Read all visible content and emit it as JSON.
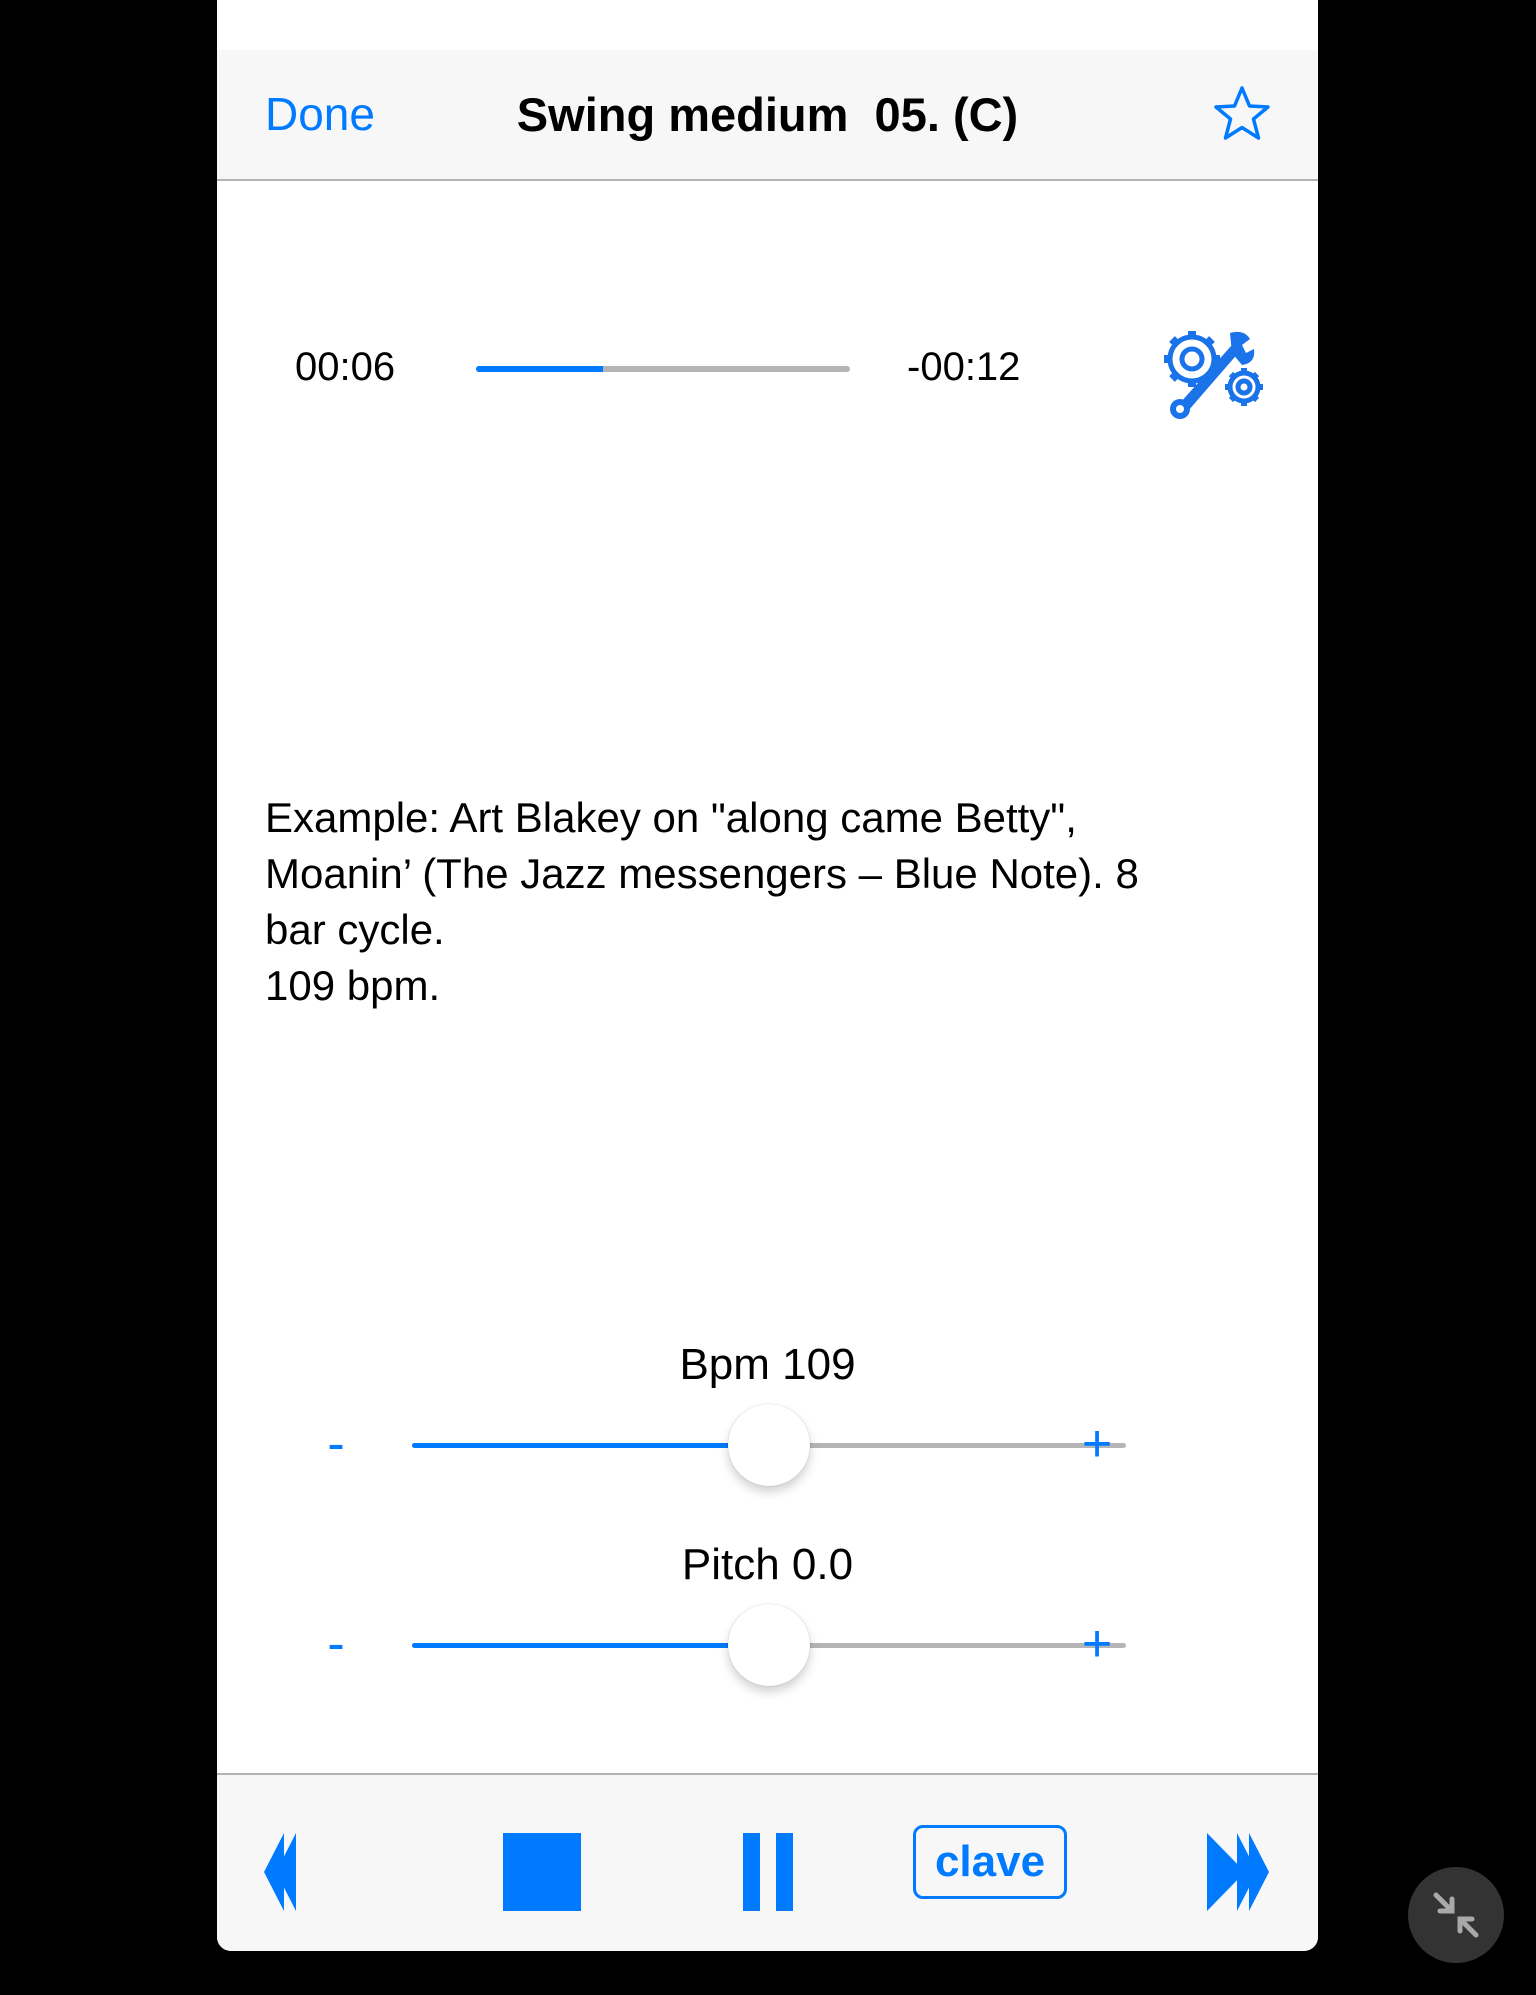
{
  "navbar": {
    "done_label": "Done",
    "title": "Swing medium  05. (C)",
    "favorite_icon": "star-outline-icon"
  },
  "player": {
    "elapsed": "00:06",
    "remaining": "-00:12",
    "progress_fraction": 0.34,
    "settings_icon": "gears-wrench-icon"
  },
  "description": {
    "lines": [
      "Example: Art Blakey on \"along came Betty\",",
      "Moanin’ (The Jazz messengers – Blue Note). 8",
      "bar cycle.",
      "109 bpm."
    ]
  },
  "bpm": {
    "label": "Bpm 109",
    "value": 109,
    "position_fraction": 0.5,
    "minus_label": "-",
    "plus_label": "+"
  },
  "pitch": {
    "label": "Pitch 0.0",
    "value": 0.0,
    "position_fraction": 0.5,
    "minus_label": "-",
    "plus_label": "+"
  },
  "toolbar": {
    "rewind_icon": "rewind-icon",
    "stop_icon": "stop-icon",
    "pause_icon": "pause-icon",
    "clave_label": "clave",
    "forward_icon": "fast-forward-icon"
  },
  "overlay": {
    "exit_fullscreen_icon": "shrink-arrows-icon"
  },
  "colors": {
    "accent": "#007aff",
    "track": "#b5b5b5",
    "bar_bg": "#f7f7f7"
  }
}
